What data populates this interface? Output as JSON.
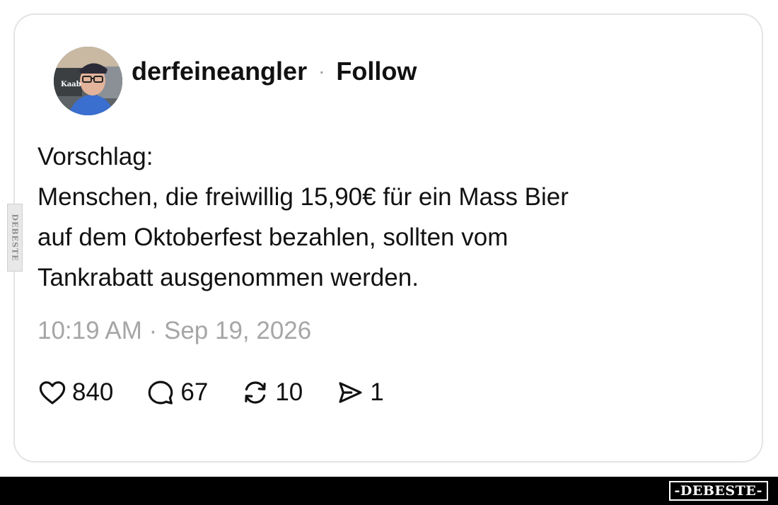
{
  "post": {
    "username": "derfeineangler",
    "separator": "·",
    "follow_label": "Follow",
    "avatar_badge": "Kaab",
    "body_lines": [
      "Vorschlag:",
      "Menschen, die freiwillig 15,90€ für ein Mass Bier",
      "auf dem Oktoberfest bezahlen, sollten vom",
      "Tankrabatt ausgenommen werden."
    ],
    "timestamp": "10:19 AM · Sep 19, 2026"
  },
  "actions": {
    "like": {
      "icon": "heart-icon",
      "count": "840"
    },
    "reply": {
      "icon": "speech-bubble-icon",
      "count": "67"
    },
    "repost": {
      "icon": "repost-icon",
      "count": "10"
    },
    "share": {
      "icon": "send-icon",
      "count": "1"
    }
  },
  "watermark": {
    "side_text": "DEBESTE",
    "bottom_logo": "-DEBESTE-"
  },
  "colors": {
    "text": "#111111",
    "muted": "#a6a6a6",
    "card_border": "#e4e4e4",
    "bottom_bar": "#000000"
  }
}
